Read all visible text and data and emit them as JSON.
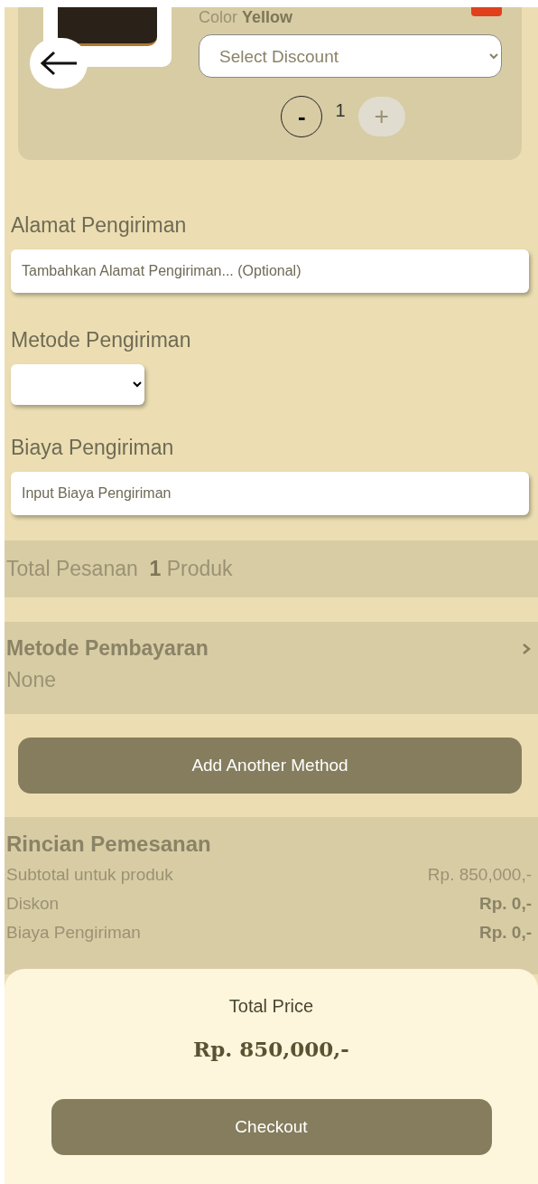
{
  "product": {
    "color_label": "Color",
    "color_value": "Yellow",
    "discount_select": {
      "value": "Select Discount"
    },
    "minus": "-",
    "quantity": "1",
    "plus": "+"
  },
  "shipping_address": {
    "label": "Alamat Pengiriman",
    "placeholder": "Tambahkan Alamat Pengiriman... (Optional)"
  },
  "shipping_method": {
    "label": "Metode Pengiriman"
  },
  "shipping_cost": {
    "label": "Biaya Pengiriman",
    "placeholder": "Input Biaya Pengiriman"
  },
  "order_total": {
    "label": "Total Pesanan",
    "count": "1",
    "unit": "Produk"
  },
  "payment": {
    "label": "Metode Pembayaran",
    "value": "None"
  },
  "add_method_button": "Add Another Method",
  "details": {
    "title": "Rincian Pemesanan",
    "rows": [
      {
        "label": "Subtotal untuk produk",
        "value": "Rp. 850,000,-",
        "bold": false
      },
      {
        "label": "Diskon",
        "value": "Rp. 0,-",
        "bold": true
      },
      {
        "label": "Biaya Pengiriman",
        "value": "Rp. 0,-",
        "bold": true
      }
    ]
  },
  "total": {
    "label": "Total Price",
    "amount": "Rp. 850,000,-"
  },
  "checkout_button": "Checkout"
}
